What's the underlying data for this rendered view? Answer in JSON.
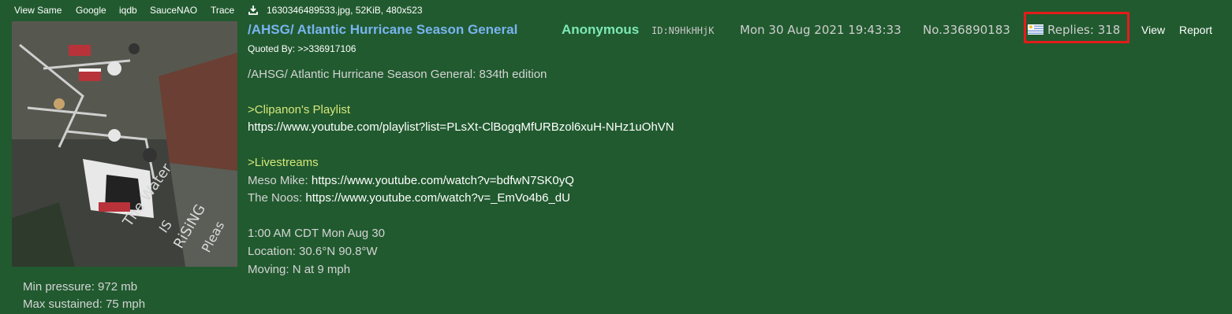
{
  "toolbar": {
    "links": [
      "View Same",
      "Google",
      "iqdb",
      "SauceNAO",
      "Trace"
    ],
    "download_icon": "download-icon",
    "file_info": "1630346489533.jpg, 52KiB, 480x523"
  },
  "post": {
    "subject": "/AHSG/ Atlantic Hurricane Season General",
    "name": "Anonymous",
    "poster_id": "ID:N9HkHHjK",
    "datetime": "Mon 30 Aug 2021 19:43:33",
    "post_no": "No.336890183",
    "flag_icon": "flag-icon",
    "replies": "Replies: 318",
    "view_label": "View",
    "report_label": "Report",
    "quoted_by_label": "Quoted By:",
    "quoted_by_link": ">>336917106",
    "thumbnail_text": [
      "The Water",
      "IS",
      "RiSiNG",
      "Pleas"
    ]
  },
  "body": {
    "line1": "/AHSG/ Atlantic Hurricane Season General: 834th edition",
    "greentext1": ">Clipanon's Playlist",
    "playlist_url": "https://www.youtube.com/playlist?list=PLsXt-ClBogqMfURBzol6xuH-NHz1uOhVN",
    "greentext2": ">Livestreams",
    "meso_label": "Meso Mike: ",
    "meso_url": "https://www.youtube.com/watch?v=bdfwN7SK0yQ",
    "noos_label": "The Noos: ",
    "noos_url": "https://www.youtube.com/watch?v=_EmVo4b6_dU",
    "time_line": "1:00 AM CDT Mon Aug 30",
    "location_line": "Location: 30.6°N 90.8°W",
    "moving_line": "Moving: N at 9 mph",
    "pressure_line": "Min pressure: 972 mb",
    "sustained_line": "Max sustained: 75 mph"
  },
  "colors": {
    "background": "#215a2f",
    "subject": "#79b4f0",
    "name": "#7de8b6",
    "greentext": "#d6e77a",
    "highlight": "#e41b1b"
  }
}
